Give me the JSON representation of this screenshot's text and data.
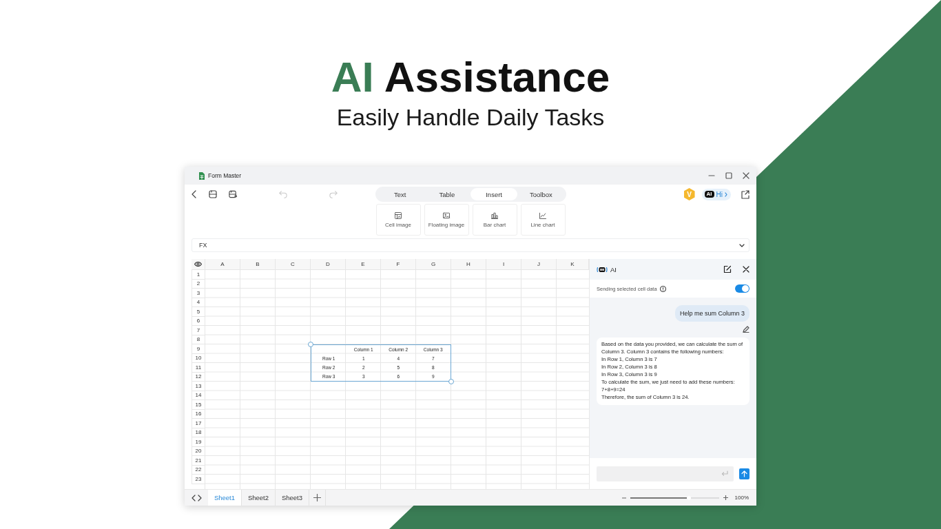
{
  "hero": {
    "accent": "AI",
    "title": "Assistance",
    "subtitle": "Easily Handle Daily Tasks"
  },
  "window": {
    "title": "Form Master"
  },
  "toolbar": {
    "undo": {
      "disabled": true
    },
    "redo": {
      "disabled": true
    },
    "badge": "V",
    "ai_button": {
      "badge": "AI",
      "label": "Hi"
    }
  },
  "tabs": [
    {
      "label": "Text",
      "selected": false
    },
    {
      "label": "Table",
      "selected": false
    },
    {
      "label": "Insert",
      "selected": true
    },
    {
      "label": "Toolbox",
      "selected": false
    }
  ],
  "ribbon": [
    {
      "kind": "cell-image",
      "label": "Cell image"
    },
    {
      "kind": "floating-image",
      "label": "Floating image"
    },
    {
      "kind": "bar-chart",
      "label": "Bar chart"
    },
    {
      "kind": "line-chart",
      "label": "Line chart"
    }
  ],
  "formula_bar": {
    "label": "FX"
  },
  "sheet": {
    "columns": [
      "A",
      "B",
      "C",
      "D",
      "E",
      "F",
      "G",
      "H",
      "I",
      "J",
      "K"
    ],
    "rows": [
      "1",
      "2",
      "3",
      "4",
      "5",
      "6",
      "7",
      "8",
      "9",
      "10",
      "11",
      "12",
      "13",
      "14",
      "15",
      "16",
      "17",
      "18",
      "19",
      "20",
      "21",
      "22",
      "23"
    ],
    "table_object": {
      "columns": [
        "Column 1",
        "Column 2",
        "Column 3"
      ],
      "rows": [
        {
          "label": "Row 1",
          "values": [
            "1",
            "4",
            "7"
          ]
        },
        {
          "label": "Row 2",
          "values": [
            "2",
            "5",
            "8"
          ]
        },
        {
          "label": "Row 3",
          "values": [
            "3",
            "6",
            "9"
          ]
        }
      ]
    }
  },
  "ai_panel": {
    "title": "AI",
    "toggle": {
      "label": "Sending selected cell data",
      "on": true
    },
    "messages": [
      {
        "kind": "user",
        "text": "Help me sum Column 3"
      },
      {
        "kind": "assistant",
        "text": "Based on the data you provided, we can calculate the sum of Column 3. Column 3 contains the following numbers:\nIn Row 1, Column 3 is 7\nIn Row 2, Column 3 is 8\nIn Row 3, Column 3 is 9\nTo calculate the sum, we just need to add these numbers:\n7+8+9=24\nTherefore, the sum of Column 3 is 24."
      }
    ]
  },
  "sheet_tabs": [
    {
      "label": "Sheet1",
      "selected": true
    },
    {
      "label": "Sheet2",
      "selected": false
    },
    {
      "label": "Sheet3",
      "selected": false
    }
  ],
  "zoom": {
    "level": 0.66,
    "reading": "100%"
  }
}
